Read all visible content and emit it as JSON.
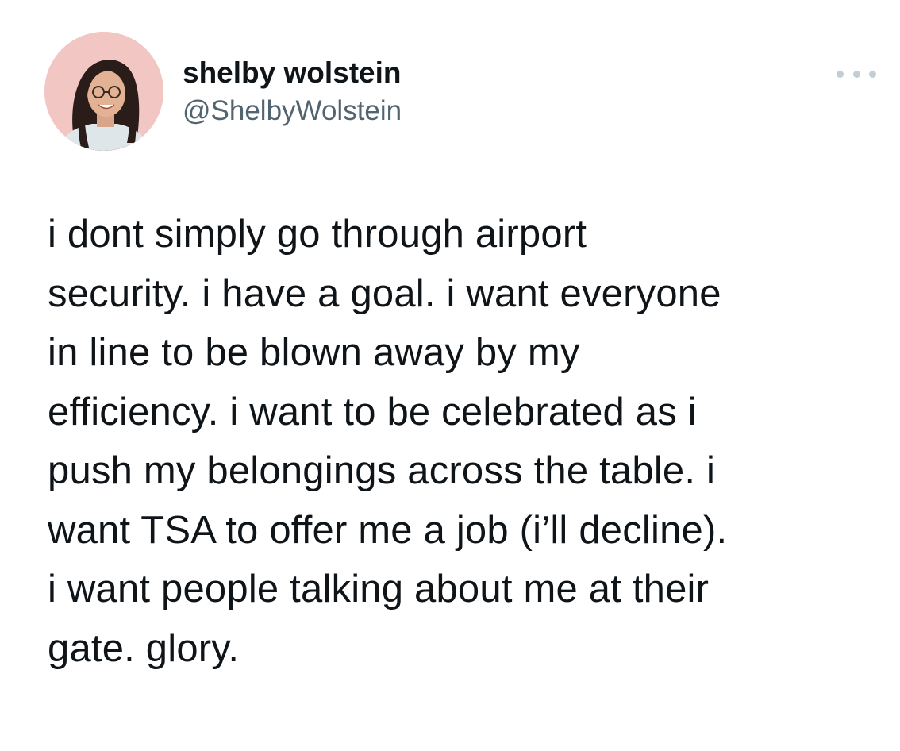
{
  "tweet": {
    "author": {
      "display_name": "shelby wolstein",
      "handle": "@ShelbyWolstein",
      "avatar_icon": "profile-photo"
    },
    "more_icon": "ellipsis-icon",
    "text_lines": [
      "i dont simply go through airport",
      "security. i have a goal. i want everyone",
      "in line to be blown away by my",
      "efficiency. i want to be celebrated as i",
      "push my belongings across the table. i",
      "want TSA to offer me a job (i’ll decline).",
      "i want people talking about me at their",
      "gate. glory."
    ]
  },
  "colors": {
    "text": "#0f1419",
    "secondary": "#536471",
    "avatar_bg": "#f2c6c2",
    "more_dots": "#c4cdd3"
  }
}
